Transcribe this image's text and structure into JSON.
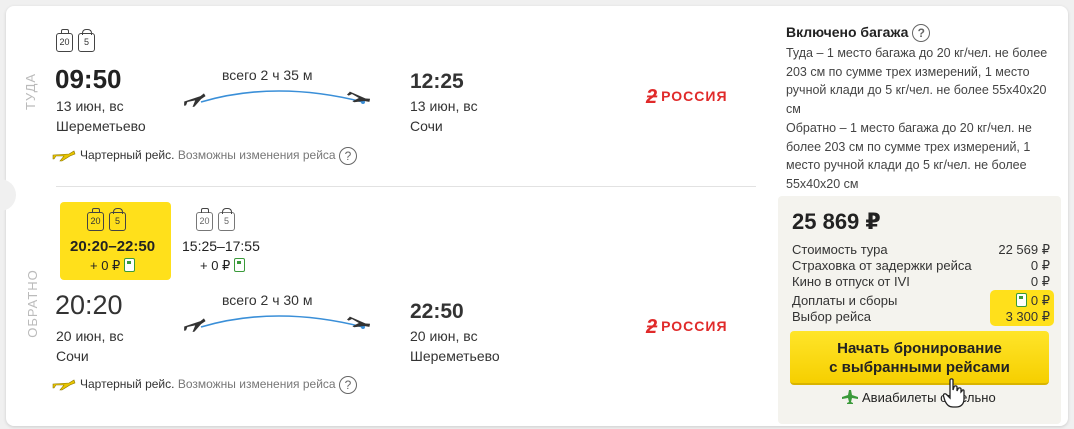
{
  "outbound": {
    "direction_label": "ТУДА",
    "baggage_kg": "20",
    "handbag_kg": "5",
    "depart_time": "09:50",
    "depart_date": "13 июн, вс",
    "depart_airport": "Шереметьево",
    "duration": "всего 2 ч 35 м",
    "arrive_time": "12:25",
    "arrive_date": "13 июн, вс",
    "arrive_airport": "Сочи",
    "airline": "РОССИЯ",
    "charter_label": "Чартерный рейс.",
    "charter_note": "Возможны изменения рейса"
  },
  "inbound": {
    "direction_label": "ОБРАТНО",
    "options": [
      {
        "baggage_kg": "20",
        "handbag_kg": "5",
        "time_range": "20:20–22:50",
        "extra": "+ 0 ₽",
        "selected": true
      },
      {
        "baggage_kg": "20",
        "handbag_kg": "5",
        "time_range": "15:25–17:55",
        "extra": "+ 0 ₽",
        "selected": false
      }
    ],
    "depart_time": "20:20",
    "depart_date": "20 июн, вс",
    "depart_airport": "Сочи",
    "duration": "всего 2 ч 30 м",
    "arrive_time": "22:50",
    "arrive_date": "20 июн, вс",
    "arrive_airport": "Шереметьево",
    "airline": "РОССИЯ",
    "charter_label": "Чартерный рейс.",
    "charter_note": "Возможны изменения рейса"
  },
  "baggage_info": {
    "title": "Включено багажа",
    "outbound_text": "Туда – 1 место багажа до 20 кг/чел. не более 203 см по сумме трех измерений, 1 место ручной клади до 5 кг/чел. не более 55x40x20 см",
    "inbound_text": "Обратно – 1 место багажа до 20 кг/чел. не более 203 см по сумме трех измерений, 1 место ручной клади до 5 кг/чел. не более 55x40x20 см"
  },
  "price": {
    "total": "25 869 ₽",
    "rows": [
      {
        "label": "Стоимость тура",
        "value": "22 569 ₽"
      },
      {
        "label": "Страховка от задержки рейса",
        "value": "0 ₽"
      },
      {
        "label": "Кино в отпуск от IVI",
        "value": "0 ₽"
      },
      {
        "label": "Доплаты и сборы",
        "value": "0 ₽"
      },
      {
        "label": "Выбор рейса",
        "value": "3 300 ₽"
      }
    ],
    "book_button_line1": "Начать бронирование",
    "book_button_line2": "с выбранными рейсами",
    "airtickets_label": "Авиабилеты отдельно"
  },
  "colors": {
    "accent_yellow": "#ffe01b",
    "route_line": "#3a8fd8",
    "airline_red": "#e02a2a",
    "fuel_green": "#3a9a3a"
  }
}
